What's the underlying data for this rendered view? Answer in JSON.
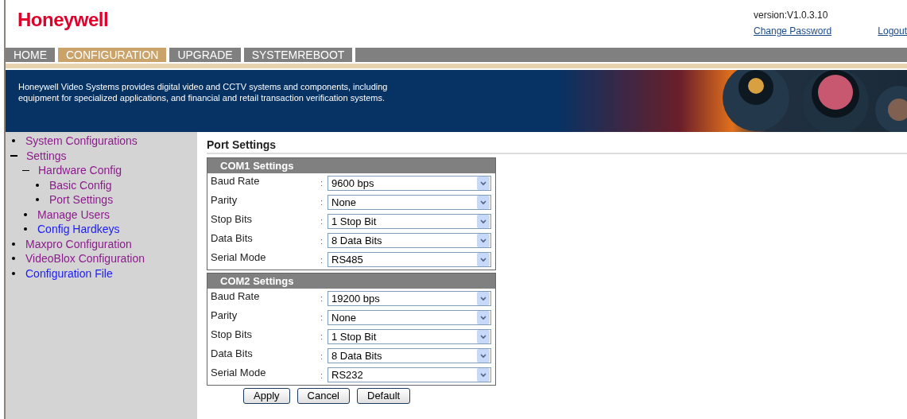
{
  "header": {
    "logo": "Honeywell",
    "version": "version:V1.0.3.10",
    "links": [
      "Change Password",
      "Logout"
    ]
  },
  "nav": [
    {
      "label": "HOME",
      "selected": false
    },
    {
      "label": "CONFIGURATION",
      "selected": true
    },
    {
      "label": "UPGRADE",
      "selected": false
    },
    {
      "label": "SYSTEMREBOOT",
      "selected": false
    }
  ],
  "banner": {
    "text": "Honeywell Video Systems provides digital video and CCTV systems and components, including equipment for specialized applications, and financial and retail transaction verification systems."
  },
  "sidebar": {
    "items": [
      {
        "label": "System Configurations",
        "visited": true,
        "expanded": false
      },
      {
        "label": "Settings",
        "visited": true,
        "expanded": true,
        "children": [
          {
            "label": "Hardware Config",
            "visited": true,
            "expanded": true,
            "children": [
              {
                "label": "Basic Config",
                "visited": true,
                "expanded": false
              },
              {
                "label": "Port Settings",
                "visited": true,
                "expanded": false
              }
            ]
          },
          {
            "label": "Manage Users",
            "visited": true,
            "expanded": false
          },
          {
            "label": "Config Hardkeys",
            "visited": false,
            "expanded": false
          }
        ]
      },
      {
        "label": "Maxpro Configuration",
        "visited": true,
        "expanded": false
      },
      {
        "label": "VideoBlox Configuration",
        "visited": true,
        "expanded": false
      },
      {
        "label": "Configuration File",
        "visited": false,
        "expanded": false
      }
    ]
  },
  "page_title": "Port Settings",
  "sections": [
    {
      "title": "COM1 Settings",
      "fields": [
        {
          "label": "Baud Rate",
          "value": "9600 bps"
        },
        {
          "label": "Parity",
          "value": "None"
        },
        {
          "label": "Stop Bits",
          "value": "1 Stop Bit"
        },
        {
          "label": "Data Bits",
          "value": "8 Data Bits"
        },
        {
          "label": "Serial Mode",
          "value": "RS485"
        }
      ]
    },
    {
      "title": "COM2 Settings",
      "fields": [
        {
          "label": "Baud Rate",
          "value": "19200 bps"
        },
        {
          "label": "Parity",
          "value": "None"
        },
        {
          "label": "Stop Bits",
          "value": "1 Stop Bit"
        },
        {
          "label": "Data Bits",
          "value": "8 Data Bits"
        },
        {
          "label": "Serial Mode",
          "value": "RS232"
        }
      ]
    }
  ],
  "separator": ":",
  "buttons": [
    "Apply",
    "Cancel",
    "Default"
  ]
}
